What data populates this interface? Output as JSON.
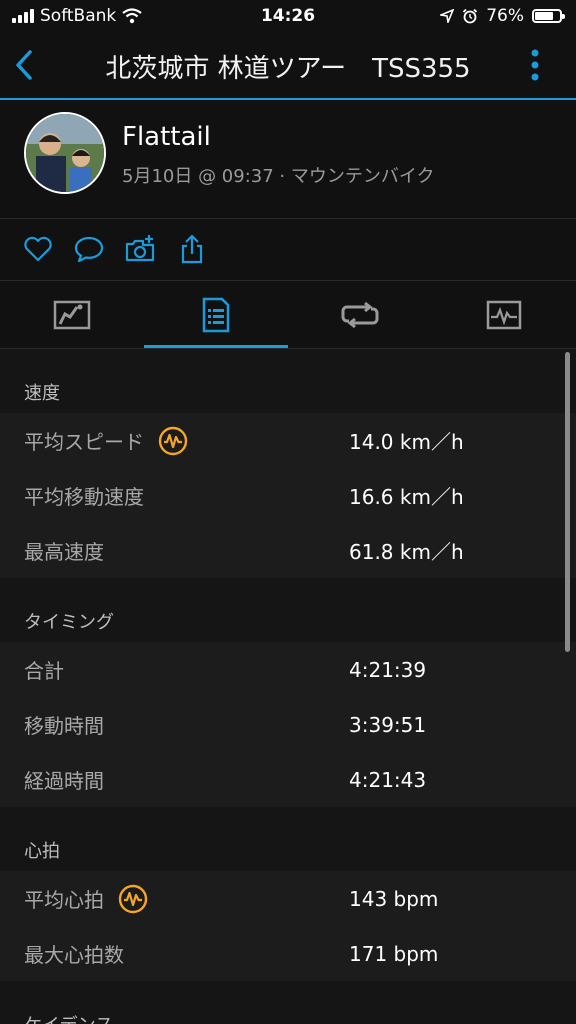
{
  "status": {
    "carrier": "SoftBank",
    "time": "14:26",
    "battery_pct": "76%",
    "battery_level": 0.76
  },
  "nav": {
    "title": "北茨城市 林道ツアー　TSS355"
  },
  "profile": {
    "name": "Flattail",
    "meta": "5月10日 @ 09:37 · マウンテンバイク"
  },
  "actions": [
    "heart-icon",
    "comment-icon",
    "camera-add-icon",
    "share-icon"
  ],
  "tabs": [
    {
      "icon": "map-tab-icon",
      "active": false
    },
    {
      "icon": "details-tab-icon",
      "active": true
    },
    {
      "icon": "laps-tab-icon",
      "active": false
    },
    {
      "icon": "chart-tab-icon",
      "active": false
    }
  ],
  "sections": {
    "speed": {
      "title": "速度",
      "rows": [
        {
          "label": "平均スピード",
          "value": "14.0 km／h"
        },
        {
          "label": "平均移動速度",
          "value": "16.6 km／h"
        },
        {
          "label": "最高速度",
          "value": "61.8 km／h"
        }
      ]
    },
    "timing": {
      "title": "タイミング",
      "rows": [
        {
          "label": "合計",
          "value": "4:21:39"
        },
        {
          "label": "移動時間",
          "value": "3:39:51"
        },
        {
          "label": "経過時間",
          "value": "4:21:43"
        }
      ]
    },
    "hr": {
      "title": "心拍",
      "rows": [
        {
          "label": "平均心拍",
          "value": "143 bpm"
        },
        {
          "label": "最大心拍数",
          "value": "171 bpm"
        }
      ]
    },
    "cadence": {
      "title": "ケイデンス"
    }
  },
  "colors": {
    "accent": "#1a9bdc",
    "badge": "#f5a623",
    "background": "#111111"
  }
}
